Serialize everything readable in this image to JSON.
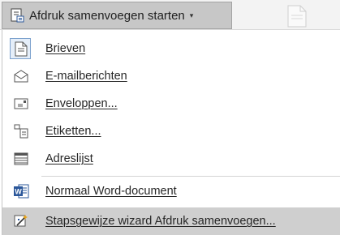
{
  "ribbon": {
    "mail_merge_button_label": "Afdruk samenvoegen starten",
    "dropdown_caret": "▾"
  },
  "menu": {
    "items": [
      {
        "label": "Brieven",
        "icon": "letter-document-icon"
      },
      {
        "label": "E-mailberichten",
        "icon": "email-envelope-icon"
      },
      {
        "label": "Enveloppen...",
        "icon": "envelope-icon"
      },
      {
        "label": "Etiketten...",
        "icon": "labels-icon"
      },
      {
        "label": "Adreslijst",
        "icon": "address-list-icon"
      },
      {
        "label": "Normaal Word-document",
        "icon": "word-document-icon"
      },
      {
        "label": "Stapsgewijze wizard Afdruk samenvoegen...",
        "icon": "wizard-icon"
      }
    ]
  },
  "colors": {
    "word_blue": "#2b579a",
    "button_pressed": "#c7c7c7",
    "hover_item": "#cfcfcf",
    "selected_border": "#7da2ce"
  }
}
